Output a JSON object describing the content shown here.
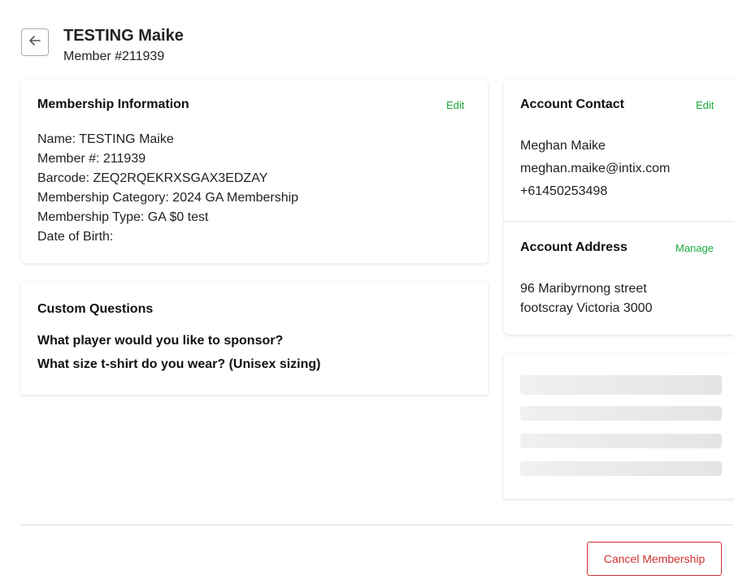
{
  "header": {
    "back_icon": "arrow-left-icon",
    "title": "TESTING Maike",
    "subtitle": "Member #211939"
  },
  "membership": {
    "title": "Membership Information",
    "edit_label": "Edit",
    "lines": [
      "Name: TESTING Maike",
      "Member #: 211939",
      "Barcode: ZEQ2RQEKRXSGAX3EDZAY",
      "Membership Category: 2024 GA Membership",
      "Membership Type: GA $0 test",
      "Date of Birth:"
    ]
  },
  "custom_questions": {
    "title": "Custom Questions",
    "questions": [
      "What player would you like to sponsor?",
      "What size t-shirt do you wear? (Unisex sizing)"
    ]
  },
  "account_contact": {
    "title": "Account Contact",
    "edit_label": "Edit",
    "name": "Meghan Maike",
    "email": "meghan.maike@intix.com",
    "phone": "+61450253498"
  },
  "account_address": {
    "title": "Account Address",
    "manage_label": "Manage",
    "line1": "96 Maribyrnong street",
    "line2": "footscray Victoria 3000"
  },
  "footer": {
    "cancel_label": "Cancel Membership"
  },
  "colors": {
    "link": "#1aa83a",
    "danger": "#d0312d"
  }
}
